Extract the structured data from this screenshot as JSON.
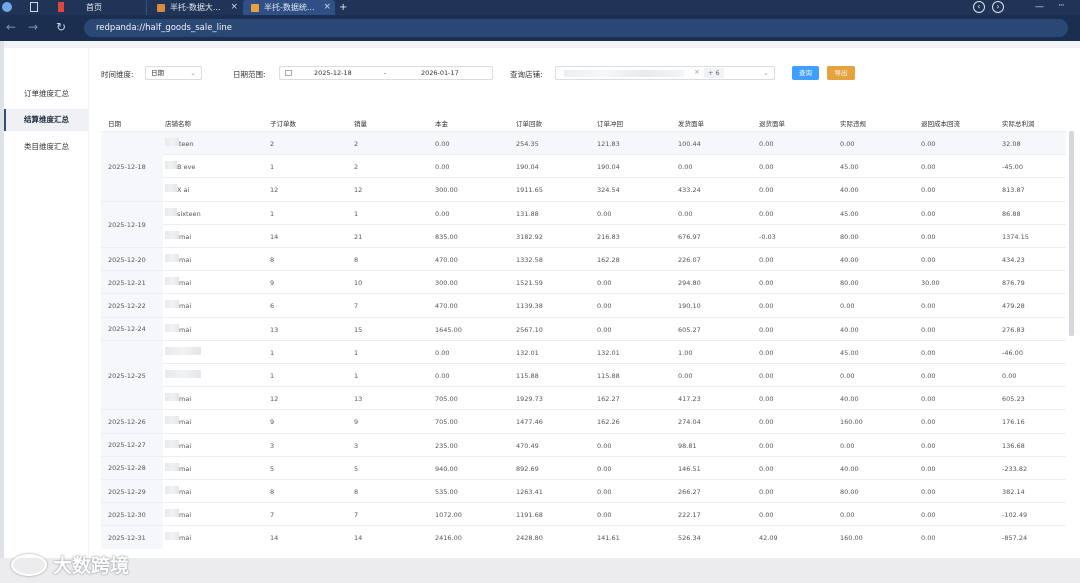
{
  "browser": {
    "tabs": [
      {
        "label": "首页",
        "active": false
      },
      {
        "label": "半托-数据大...",
        "active": false
      },
      {
        "label": "半托-数据统...",
        "active": true
      }
    ],
    "address": "redpanda://half_goods_sale_line",
    "accent": "#1f3456"
  },
  "sidebar": {
    "items": [
      {
        "label": "订单维度汇总",
        "active": false
      },
      {
        "label": "结算维度汇总",
        "active": true
      },
      {
        "label": "类目维度汇总",
        "active": false
      }
    ]
  },
  "filters": {
    "time_dim_label": "时间维度:",
    "time_dim_value": "日期",
    "date_range_label": "日期范围:",
    "date_start": "2025-12-18",
    "date_sep": "-",
    "date_end": "2026-01-17",
    "store_label": "查询店铺:",
    "store_more": "+ 6",
    "query_button": "查询",
    "export_button": "导出",
    "query_color": "#409eff",
    "export_color": "#e6a23c"
  },
  "table": {
    "columns": [
      "日期",
      "店铺名称",
      "子订单数",
      "销量",
      "本金",
      "订单回款",
      "订单冲回",
      "发货面单",
      "退货面单",
      "实际违规",
      "退回成本回流",
      "实际总利润"
    ],
    "groups": [
      {
        "date": "2025-12-18",
        "rows": [
          {
            "store": "teen",
            "vals": [
              "2",
              "2",
              "0.00",
              "254.35",
              "121.83",
              "100.44",
              "0.00",
              "0.00",
              "0.00",
              "32.08"
            ]
          },
          {
            "store": "B eve",
            "vals": [
              "1",
              "2",
              "0.00",
              "190.04",
              "190.04",
              "0.00",
              "0.00",
              "45.00",
              "0.00",
              "-45.00"
            ]
          },
          {
            "store": "X   ai",
            "vals": [
              "12",
              "12",
              "300.00",
              "1911.65",
              "324.54",
              "433.24",
              "0.00",
              "40.00",
              "0.00",
              "813.87"
            ]
          }
        ]
      },
      {
        "date": "2025-12-19",
        "rows": [
          {
            "store": "sixteen",
            "vals": [
              "1",
              "1",
              "0.00",
              "131.88",
              "0.00",
              "0.00",
              "0.00",
              "45.00",
              "0.00",
              "86.88"
            ]
          },
          {
            "store": "mai",
            "vals": [
              "14",
              "21",
              "835.00",
              "3182.92",
              "216.83",
              "676.97",
              "-0.03",
              "80.00",
              "0.00",
              "1374.15"
            ]
          }
        ]
      },
      {
        "date": "2025-12-20",
        "rows": [
          {
            "store": "mai",
            "vals": [
              "8",
              "8",
              "470.00",
              "1332.58",
              "162.28",
              "226.07",
              "0.00",
              "40.00",
              "0.00",
              "434.23"
            ]
          }
        ]
      },
      {
        "date": "2025-12-21",
        "rows": [
          {
            "store": "mai",
            "vals": [
              "9",
              "10",
              "300.00",
              "1521.59",
              "0.00",
              "294.80",
              "0.00",
              "80.00",
              "30.00",
              "876.79"
            ]
          }
        ]
      },
      {
        "date": "2025-12-22",
        "rows": [
          {
            "store": "mai",
            "vals": [
              "6",
              "7",
              "470.00",
              "1139.38",
              "0.00",
              "190.10",
              "0.00",
              "0.00",
              "0.00",
              "479.28"
            ]
          }
        ]
      },
      {
        "date": "2025-12-24",
        "rows": [
          {
            "store": "mai",
            "vals": [
              "13",
              "15",
              "1645.00",
              "2567.10",
              "0.00",
              "605.27",
              "0.00",
              "40.00",
              "0.00",
              "276.83"
            ]
          }
        ]
      },
      {
        "date": "2025-12-25",
        "rows": [
          {
            "store": "",
            "vals": [
              "1",
              "1",
              "0.00",
              "132.01",
              "132.01",
              "1.00",
              "0.00",
              "45.00",
              "0.00",
              "-46.00"
            ]
          },
          {
            "store": "",
            "vals": [
              "1",
              "1",
              "0.00",
              "115.88",
              "115.88",
              "0.00",
              "0.00",
              "0.00",
              "0.00",
              "0.00"
            ]
          },
          {
            "store": "mai",
            "vals": [
              "12",
              "13",
              "705.00",
              "1929.73",
              "162.27",
              "417.23",
              "0.00",
              "40.00",
              "0.00",
              "605.23"
            ]
          }
        ]
      },
      {
        "date": "2025-12-26",
        "rows": [
          {
            "store": "mai",
            "vals": [
              "9",
              "9",
              "705.00",
              "1477.46",
              "162.26",
              "274.04",
              "0.00",
              "160.00",
              "0.00",
              "176.16"
            ]
          }
        ]
      },
      {
        "date": "2025-12-27",
        "rows": [
          {
            "store": "mai",
            "vals": [
              "3",
              "3",
              "235.00",
              "470.49",
              "0.00",
              "98.81",
              "0.00",
              "0.00",
              "0.00",
              "136.68"
            ]
          }
        ]
      },
      {
        "date": "2025-12-28",
        "rows": [
          {
            "store": "mai",
            "vals": [
              "5",
              "5",
              "940.00",
              "892.69",
              "0.00",
              "146.51",
              "0.00",
              "40.00",
              "0.00",
              "-233.82"
            ]
          }
        ]
      },
      {
        "date": "2025-12-29",
        "rows": [
          {
            "store": "mai",
            "vals": [
              "8",
              "8",
              "535.00",
              "1263.41",
              "0.00",
              "266.27",
              "0.00",
              "80.00",
              "0.00",
              "382.14"
            ]
          }
        ]
      },
      {
        "date": "2025-12-30",
        "rows": [
          {
            "store": "mai",
            "vals": [
              "7",
              "7",
              "1072.00",
              "1191.68",
              "0.00",
              "222.17",
              "0.00",
              "0.00",
              "0.00",
              "-102.49"
            ]
          }
        ]
      },
      {
        "date": "2025-12-31",
        "rows": [
          {
            "store": "mai",
            "vals": [
              "14",
              "14",
              "2416.00",
              "2428.80",
              "141.61",
              "526.34",
              "42.09",
              "160.00",
              "0.00",
              "-857.24"
            ]
          }
        ]
      }
    ]
  },
  "watermark": {
    "text": "大数跨境"
  }
}
